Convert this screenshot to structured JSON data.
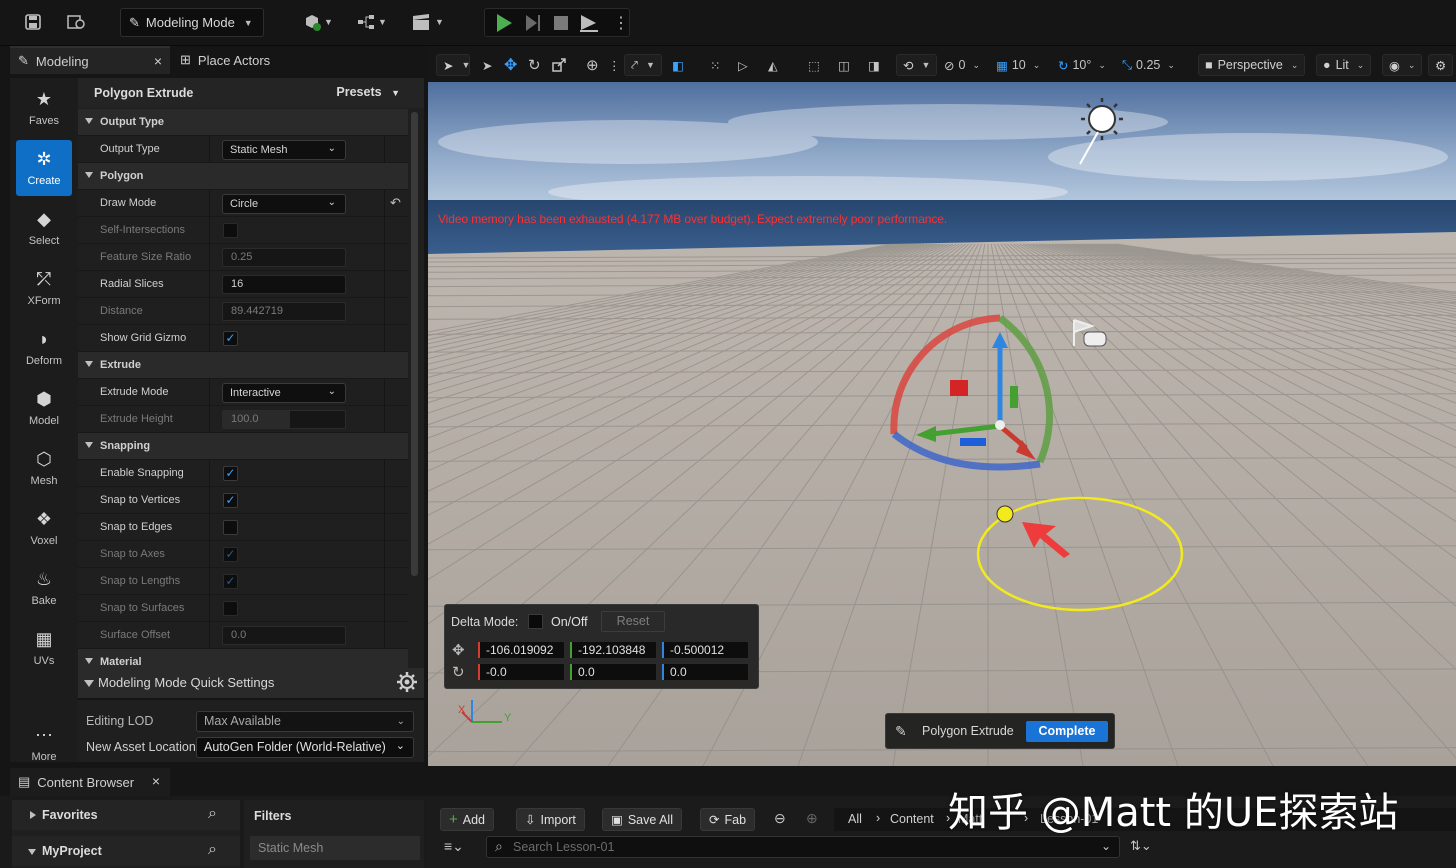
{
  "toolbar": {
    "mode_label": "Modeling Mode"
  },
  "tabs": [
    {
      "label": "Modeling",
      "close": "×"
    },
    {
      "label": "Place Actors"
    }
  ],
  "leftbar": [
    {
      "label": "Faves",
      "icon": "star-icon"
    },
    {
      "label": "Create",
      "icon": "create-icon",
      "active": true
    },
    {
      "label": "Select",
      "icon": "select-icon"
    },
    {
      "label": "XForm",
      "icon": "xform-icon"
    },
    {
      "label": "Deform",
      "icon": "deform-icon"
    },
    {
      "label": "Model",
      "icon": "model-icon"
    },
    {
      "label": "Mesh",
      "icon": "mesh-icon"
    },
    {
      "label": "Voxel",
      "icon": "voxel-icon"
    },
    {
      "label": "Bake",
      "icon": "bake-icon"
    },
    {
      "label": "UVs",
      "icon": "uvs-icon"
    },
    {
      "label": "More",
      "icon": "more-icon"
    }
  ],
  "panel": {
    "title": "Polygon Extrude",
    "presets": "Presets",
    "rows": [
      {
        "kind": "cat",
        "label": "Output Type"
      },
      {
        "kind": "select",
        "label": "Output Type",
        "value": "Static Mesh"
      },
      {
        "kind": "cat",
        "label": "Polygon"
      },
      {
        "kind": "select",
        "label": "Draw Mode",
        "value": "Circle",
        "reset": true
      },
      {
        "kind": "check",
        "label": "Self-Intersections",
        "checked": false,
        "dim": true
      },
      {
        "kind": "field",
        "label": "Feature Size Ratio",
        "value": "0.25",
        "dim": true
      },
      {
        "kind": "field",
        "label": "Radial Slices",
        "value": "16"
      },
      {
        "kind": "field",
        "label": "Distance",
        "value": "89.442719",
        "dim": true
      },
      {
        "kind": "check",
        "label": "Show Grid Gizmo",
        "checked": true
      },
      {
        "kind": "cat",
        "label": "Extrude"
      },
      {
        "kind": "select",
        "label": "Extrude Mode",
        "value": "Interactive"
      },
      {
        "kind": "field",
        "label": "Extrude Height",
        "value": "100.0",
        "dim": true
      },
      {
        "kind": "cat",
        "label": "Snapping"
      },
      {
        "kind": "check",
        "label": "Enable Snapping",
        "checked": true
      },
      {
        "kind": "check",
        "label": "Snap to Vertices",
        "checked": true
      },
      {
        "kind": "check",
        "label": "Snap to Edges",
        "checked": false
      },
      {
        "kind": "check",
        "label": "Snap to Axes",
        "checked": true,
        "dim": true
      },
      {
        "kind": "check",
        "label": "Snap to Lengths",
        "checked": true,
        "dim": true
      },
      {
        "kind": "check",
        "label": "Snap to Surfaces",
        "checked": false,
        "dim": true
      },
      {
        "kind": "field",
        "label": "Surface Offset",
        "value": "0.0",
        "dim": true
      },
      {
        "kind": "cat",
        "label": "Material"
      }
    ]
  },
  "quick_settings": {
    "title": "Modeling Mode Quick Settings",
    "editing_lod_label": "Editing LOD",
    "editing_lod_value": "Max Available",
    "new_asset_label": "New Asset Location",
    "new_asset_value": "AutoGen Folder (World-Relative)"
  },
  "viewport_toolbar": {
    "angle_snap": "0",
    "grid_snap": "10",
    "rot_snap": "10°",
    "scale_snap": "0.25",
    "view": "Perspective",
    "lit": "Lit"
  },
  "viewport": {
    "warning": "Video memory has been exhausted (4.177 MB over budget). Expect extremely poor performance.",
    "axis_x": "X",
    "axis_y": "Y"
  },
  "delta": {
    "label": "Delta Mode:",
    "toggle": "On/Off",
    "reset": "Reset",
    "loc": [
      "-106.019092",
      "-192.103848",
      "-0.500012"
    ],
    "rot": [
      "-0.0",
      "0.0",
      "0.0"
    ]
  },
  "tool_status": {
    "name": "Polygon Extrude",
    "complete": "Complete"
  },
  "content_browser": {
    "tab": "Content Browser",
    "close": "×",
    "favorites": "Favorites",
    "project": "MyProject",
    "filters": "Filters",
    "filter_item": "Static Mesh",
    "add": "Add",
    "import": "Import",
    "save_all": "Save All",
    "fab": "Fab",
    "path": [
      "All",
      "Content",
      "Matt",
      "Lesson-01"
    ],
    "search_placeholder": "Search Lesson-01"
  },
  "watermark": "知乎 @Matt 的UE探索站",
  "colors": {
    "accent": "#0f6fc6",
    "warning": "#ff3030",
    "play": "#4caf50"
  }
}
